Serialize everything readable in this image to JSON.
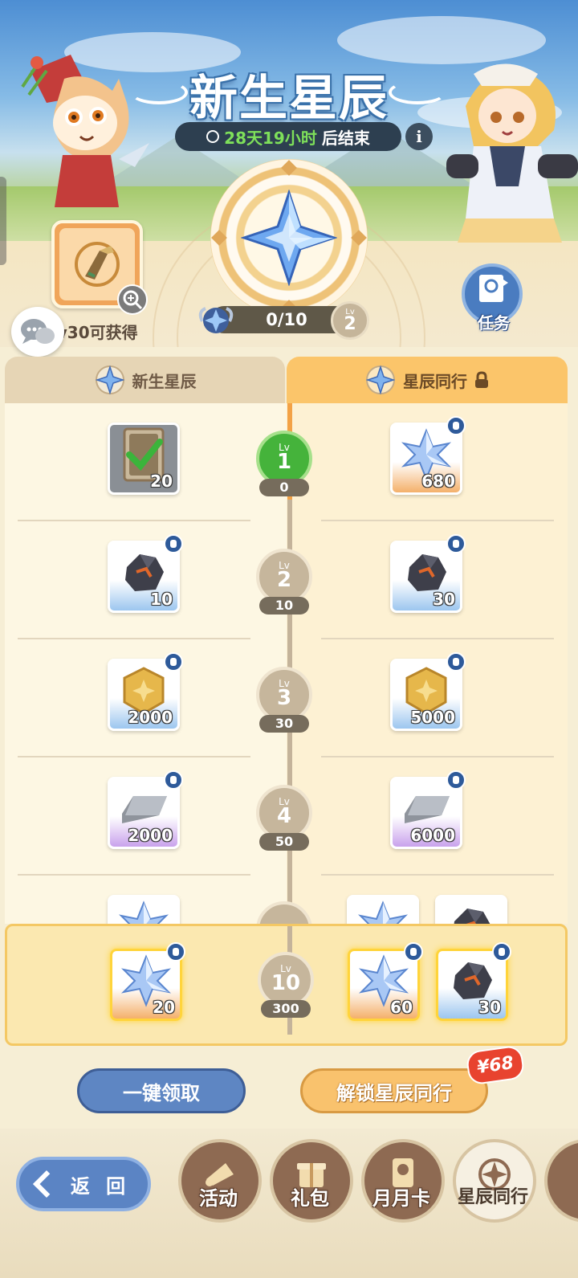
{
  "header": {
    "title": "新生星辰",
    "timer_highlight": "28天19小时",
    "timer_suffix": "后结束",
    "info_label": "i"
  },
  "progress": {
    "value": "0/10",
    "level_label": "Lv",
    "level": "2"
  },
  "preview": {
    "unlock_text": "Lv30可获得"
  },
  "tasks_label": "任务",
  "tabs": {
    "free": "新生星辰",
    "premium": "星辰同行"
  },
  "rows": [
    {
      "lv_label": "Lv",
      "level": "1",
      "xp": "0",
      "free": {
        "qty": "20",
        "kind": "card",
        "claimed": true
      },
      "premium": [
        {
          "qty": "680",
          "kind": "crystal"
        }
      ]
    },
    {
      "lv_label": "Lv",
      "level": "2",
      "xp": "10",
      "free": {
        "qty": "10",
        "kind": "ore"
      },
      "premium": [
        {
          "qty": "30",
          "kind": "ore"
        }
      ]
    },
    {
      "lv_label": "Lv",
      "level": "3",
      "xp": "30",
      "free": {
        "qty": "2000",
        "kind": "coin"
      },
      "premium": [
        {
          "qty": "5000",
          "kind": "coin"
        }
      ]
    },
    {
      "lv_label": "Lv",
      "level": "4",
      "xp": "50",
      "free": {
        "qty": "2000",
        "kind": "ingot"
      },
      "premium": [
        {
          "qty": "6000",
          "kind": "ingot"
        }
      ]
    }
  ],
  "highlight_row": {
    "lv_label": "Lv",
    "level": "10",
    "xp": "300",
    "free": {
      "qty": "20",
      "kind": "crystal"
    },
    "premium": [
      {
        "qty": "60",
        "kind": "crystal"
      },
      {
        "qty": "30",
        "kind": "ore"
      }
    ]
  },
  "buttons": {
    "claim_all": "一键领取",
    "unlock": "解锁星辰同行",
    "price": "¥68"
  },
  "nav": {
    "back": "返 回",
    "items": [
      "活动",
      "礼包",
      "月月卡",
      "星辰同行"
    ]
  },
  "colors": {
    "accent_orange": "#fbc56a",
    "accent_blue": "#5e86c3",
    "claimed_green": "#45b33b",
    "price_red": "#e8432f"
  }
}
